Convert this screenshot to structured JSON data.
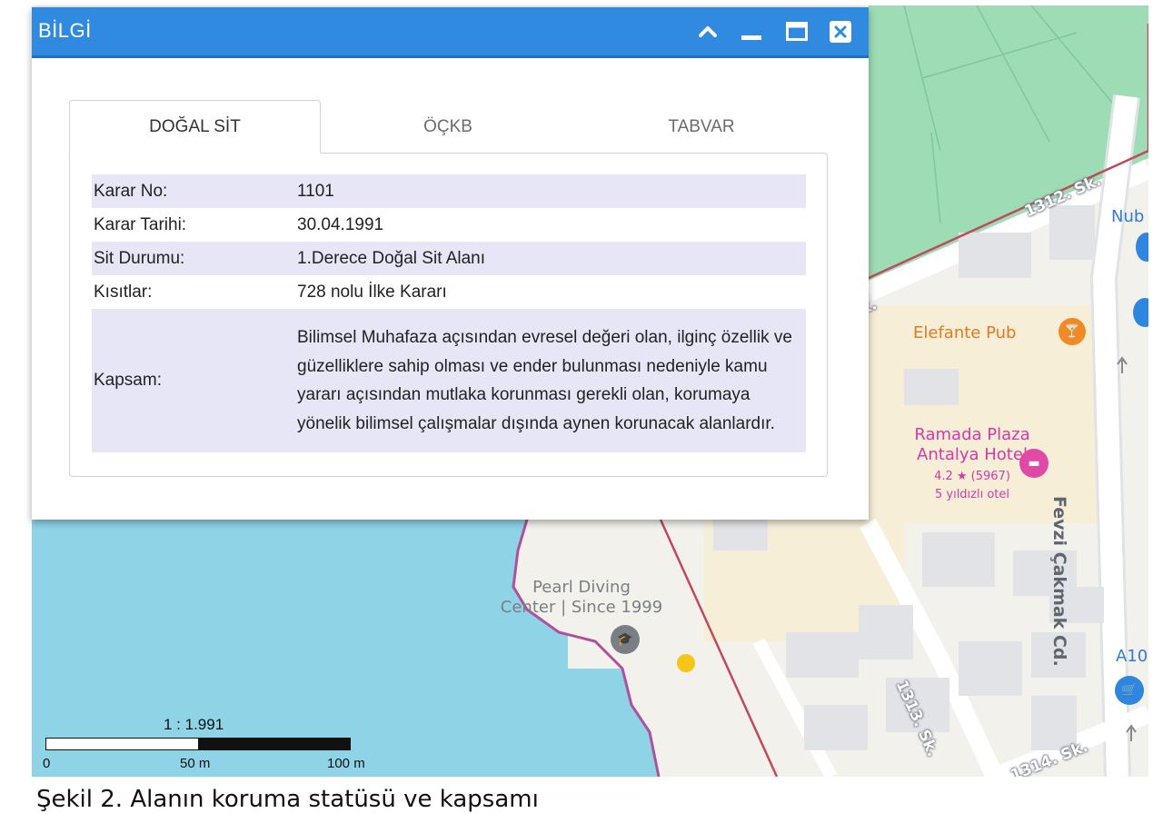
{
  "window": {
    "title": "BİLGİ",
    "buttons": {
      "collapse": "chevron-up",
      "minimize": "minimize",
      "maximize": "maximize",
      "close": "close"
    }
  },
  "tabs": [
    {
      "label": "DOĞAL SİT",
      "active": true
    },
    {
      "label": "ÖÇKB",
      "active": false
    },
    {
      "label": "TABVAR",
      "active": false
    }
  ],
  "info": {
    "rows": [
      {
        "key": "Karar No:",
        "value": "1101"
      },
      {
        "key": "Karar Tarihi:",
        "value": "30.04.1991"
      },
      {
        "key": "Sit Durumu:",
        "value": "1.Derece Doğal Sit Alanı"
      },
      {
        "key": "Kısıtlar:",
        "value": "728 nolu İlke Kararı"
      },
      {
        "key": "Kapsam:",
        "value": "Bilimsel Muhafaza açısından evresel değeri olan, ilginç özellik ve güzelliklere sahip olması ve ender bulunması nedeniyle kamu yararı açısından mutlaka korunması gerekli olan, korumaya yönelik bilimsel çalışmalar dışında aynen korunacak alanlardır."
      }
    ]
  },
  "map": {
    "labels": {
      "pub": "Elefante Pub",
      "hotel_line1": "Ramada Plaza",
      "hotel_line2": "Antalya Hotel",
      "hotel_rating": "4.2 ★ (5967)",
      "hotel_class": "5 yıldızlı otel",
      "diving_line1": "Pearl Diving",
      "diving_line2": "Center | Since 1999",
      "street_1312": "1312. Sk.",
      "street_1313": "1313. Sk.",
      "street_1314": "1314. Sk.",
      "street_fevzi": "Fevzi Çakmak Cd.",
      "partial_nub": "Nub",
      "partial_a10": "A10",
      "partial_k": "k."
    },
    "colors": {
      "park": "#9edcb6",
      "sea": "#8ed3e6",
      "land": "#f3f1ec",
      "road": "#ffffff",
      "boundary": "#c04a5a",
      "coast": "#b0509a",
      "building": "#e2e3e6"
    },
    "scale": {
      "ratio": "1 : 1.991",
      "ticks": [
        "0",
        "50 m",
        "100 m"
      ]
    }
  },
  "caption": "Şekil 2. Alanın koruma statüsü ve kapsamı"
}
